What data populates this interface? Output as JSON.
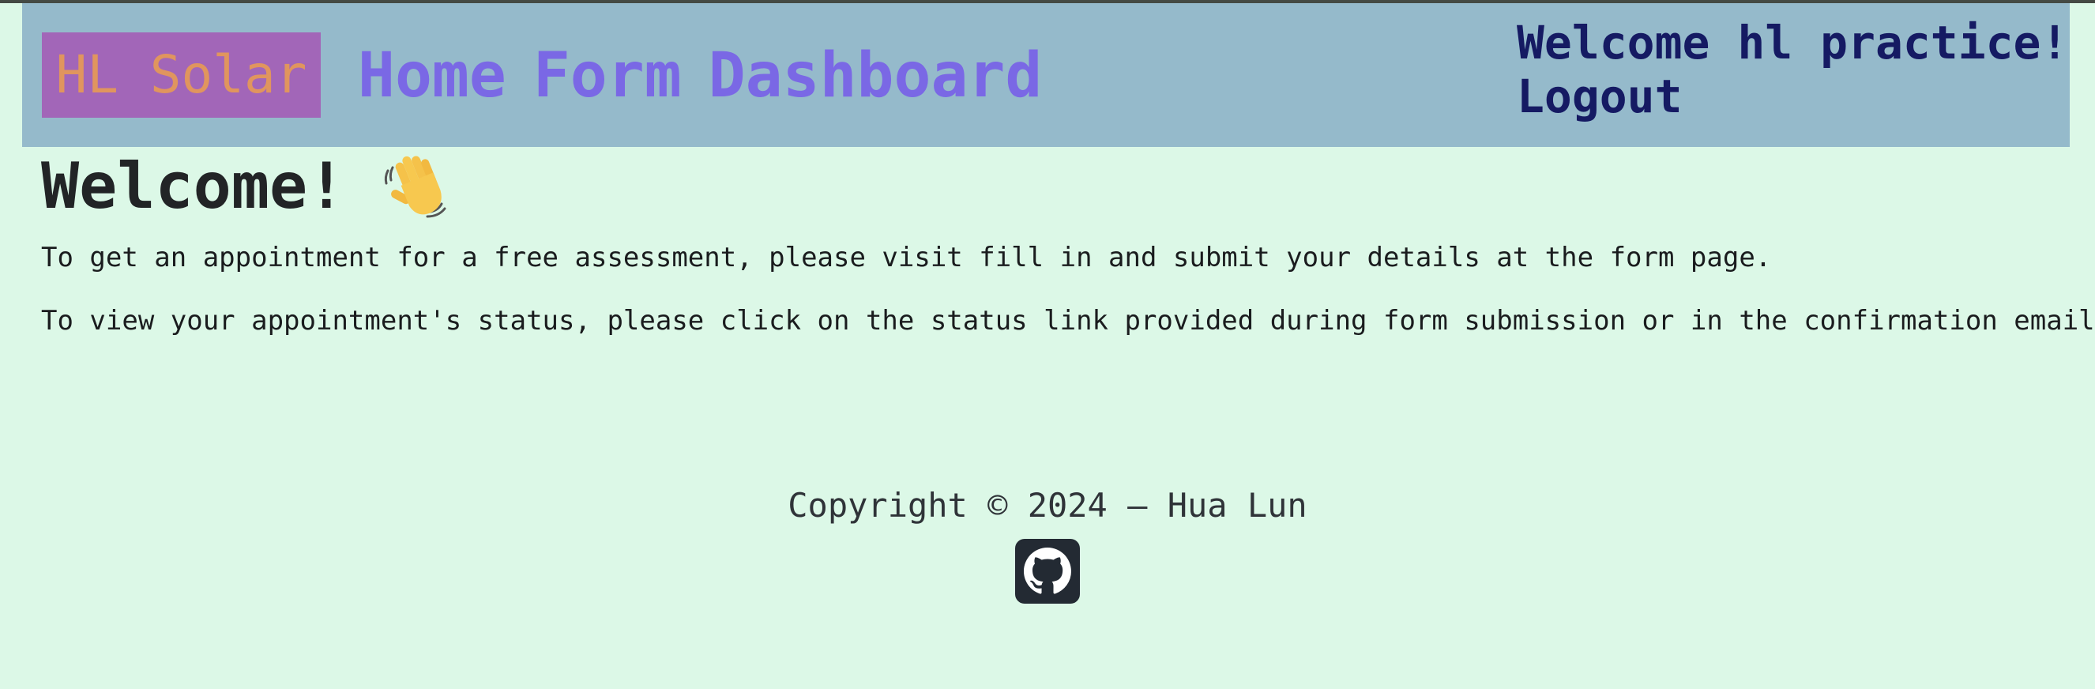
{
  "header": {
    "brand": "HL Solar",
    "nav": [
      {
        "label": "Home"
      },
      {
        "label": "Form"
      },
      {
        "label": "Dashboard"
      }
    ],
    "greeting": "Welcome hl practice!",
    "logout_label": "Logout"
  },
  "main": {
    "title": "Welcome!",
    "title_icon": "waving-hand-icon",
    "paragraphs": [
      "To get an appointment for a free assessment, please visit fill in and submit your details at the form page.",
      "To view your appointment's status, please click on the status link provided during form submission or in the confirmation email."
    ]
  },
  "footer": {
    "copyright": "Copyright © 2024 — Hua Lun",
    "icon": "github-icon"
  },
  "colors": {
    "page_bg": "#dcf8e7",
    "navbar_bg": "#95bacb",
    "brand_bg": "#a266b8",
    "brand_text": "#e0955e",
    "nav_link": "#7a68e5",
    "user_text": "#151a63"
  }
}
